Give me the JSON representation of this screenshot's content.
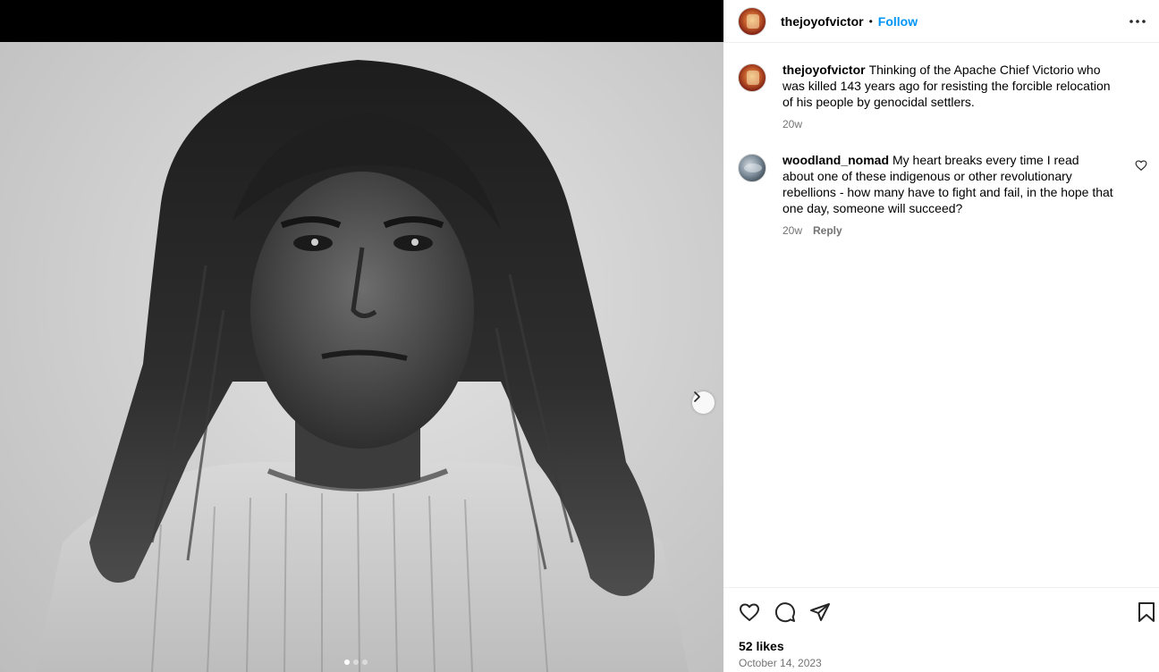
{
  "post": {
    "author": "thejoyofvictor",
    "separator": "•",
    "follow_label": "Follow",
    "caption": "Thinking of the Apache Chief Victorio who was killed 143 years ago for resisting the forcible relocation of his people by genocidal settlers.",
    "caption_age": "20w",
    "likes": "52 likes",
    "date": "October 14, 2023",
    "media_slide": 1,
    "media_slide_count": 3
  },
  "comments": [
    {
      "user": "woodland_nomad",
      "text": "My heart breaks every time I read about one of these indigenous or other revolutionary rebellions - how many have to fight and fail, in the hope that one day, someone will succeed?",
      "age": "20w",
      "reply_label": "Reply"
    }
  ],
  "icons": {
    "more": "more-options-icon",
    "like": "heart-icon",
    "comment": "comment-icon",
    "share": "share-icon",
    "save": "bookmark-icon",
    "next": "chevron-right-icon"
  },
  "colors": {
    "accent": "#0095f6",
    "muted_text": "#737373",
    "divider": "#efefef"
  }
}
